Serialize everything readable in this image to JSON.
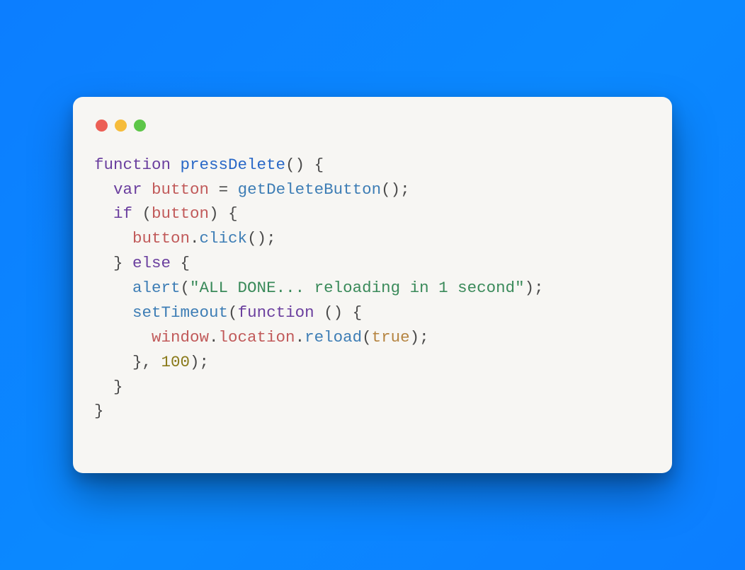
{
  "colors": {
    "background_gradient": [
      "#0c7eff",
      "#0b89ff"
    ],
    "window_bg": "#f7f6f3",
    "dot_red": "#ec5f55",
    "dot_yellow": "#f6bc3a",
    "dot_green": "#5dc648",
    "syntax": {
      "keyword": "#6a3e9e",
      "function_name": "#2968c7",
      "call": "#3d7db5",
      "variable": "#c15a5a",
      "string": "#3a8a5a",
      "number": "#8a7a1a",
      "boolean": "#b58440",
      "default": "#4a4a4a"
    }
  },
  "code": {
    "language": "javascript",
    "tokens": [
      {
        "t": "function ",
        "c": "kw"
      },
      {
        "t": "pressDelete",
        "c": "fn"
      },
      {
        "t": "() {",
        "c": "punct"
      },
      {
        "t": "\n"
      },
      {
        "t": "  "
      },
      {
        "t": "var ",
        "c": "kw"
      },
      {
        "t": "button",
        "c": "var"
      },
      {
        "t": " ",
        "c": "punct"
      },
      {
        "t": "=",
        "c": "op"
      },
      {
        "t": " ",
        "c": "punct"
      },
      {
        "t": "getDeleteButton",
        "c": "call"
      },
      {
        "t": "();",
        "c": "punct"
      },
      {
        "t": "\n"
      },
      {
        "t": "  "
      },
      {
        "t": "if",
        "c": "kw"
      },
      {
        "t": " (",
        "c": "punct"
      },
      {
        "t": "button",
        "c": "var"
      },
      {
        "t": ") {",
        "c": "punct"
      },
      {
        "t": "\n"
      },
      {
        "t": "    "
      },
      {
        "t": "button",
        "c": "var"
      },
      {
        "t": ".",
        "c": "punct"
      },
      {
        "t": "click",
        "c": "call"
      },
      {
        "t": "();",
        "c": "punct"
      },
      {
        "t": "\n"
      },
      {
        "t": "  } ",
        "c": "punct"
      },
      {
        "t": "else",
        "c": "kw"
      },
      {
        "t": " {",
        "c": "punct"
      },
      {
        "t": "\n"
      },
      {
        "t": "    "
      },
      {
        "t": "alert",
        "c": "call"
      },
      {
        "t": "(",
        "c": "punct"
      },
      {
        "t": "\"ALL DONE... reloading in 1 second\"",
        "c": "str"
      },
      {
        "t": ");",
        "c": "punct"
      },
      {
        "t": "\n"
      },
      {
        "t": "    "
      },
      {
        "t": "setTimeout",
        "c": "call"
      },
      {
        "t": "(",
        "c": "punct"
      },
      {
        "t": "function ",
        "c": "kw"
      },
      {
        "t": "() {",
        "c": "punct"
      },
      {
        "t": "\n"
      },
      {
        "t": "      "
      },
      {
        "t": "window",
        "c": "var"
      },
      {
        "t": ".",
        "c": "punct"
      },
      {
        "t": "location",
        "c": "var"
      },
      {
        "t": ".",
        "c": "punct"
      },
      {
        "t": "reload",
        "c": "call"
      },
      {
        "t": "(",
        "c": "punct"
      },
      {
        "t": "true",
        "c": "bool"
      },
      {
        "t": ");",
        "c": "punct"
      },
      {
        "t": "\n"
      },
      {
        "t": "    }, ",
        "c": "punct"
      },
      {
        "t": "100",
        "c": "num"
      },
      {
        "t": ");",
        "c": "punct"
      },
      {
        "t": "\n"
      },
      {
        "t": "  }",
        "c": "punct"
      },
      {
        "t": "\n"
      },
      {
        "t": "}",
        "c": "punct"
      }
    ],
    "plain": "function pressDelete() {\n  var button = getDeleteButton();\n  if (button) {\n    button.click();\n  } else {\n    alert(\"ALL DONE... reloading in 1 second\");\n    setTimeout(function () {\n      window.location.reload(true);\n    }, 100);\n  }\n}"
  }
}
